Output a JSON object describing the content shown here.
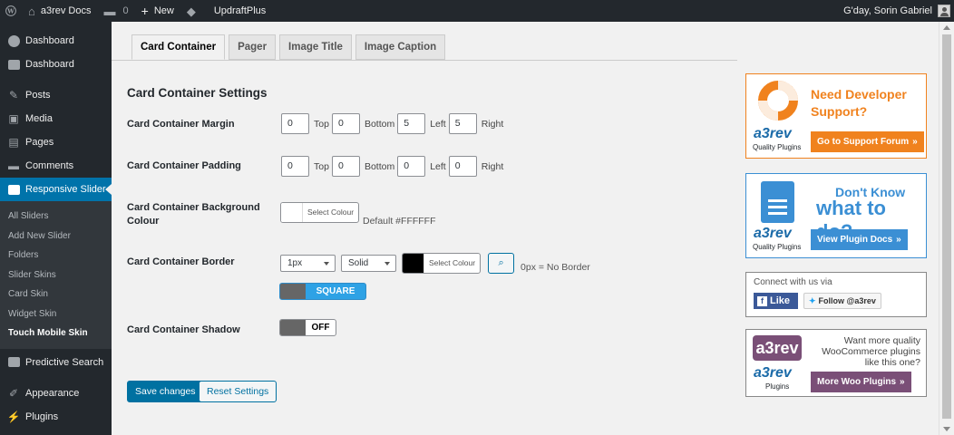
{
  "adminbar": {
    "site_name": "a3rev Docs",
    "comments_count": "0",
    "new_label": "New",
    "updraft_label": "UpdraftPlus",
    "greeting": "G'day, Sorin Gabriel"
  },
  "sidebar": {
    "items_top": [
      {
        "label": "Dashboard",
        "icon": "gauge-icon"
      },
      {
        "label": "Dashboard",
        "icon": "a3-icon"
      }
    ],
    "items_mid": [
      {
        "label": "Posts",
        "icon": "pin-icon"
      },
      {
        "label": "Media",
        "icon": "media-icon"
      },
      {
        "label": "Pages",
        "icon": "pages-icon"
      },
      {
        "label": "Comments",
        "icon": "comment-icon"
      }
    ],
    "current": {
      "label": "Responsive Slider",
      "icon": "slider-icon"
    },
    "submenu": [
      "All Sliders",
      "Add New Slider",
      "Folders",
      "Slider Skins",
      "Card Skin",
      "Widget Skin",
      "Touch Mobile Skin"
    ],
    "items_bottom": [
      {
        "label": "Predictive Search",
        "icon": "a3-icon"
      },
      {
        "label": "Appearance",
        "icon": "brush-icon"
      },
      {
        "label": "Plugins",
        "icon": "plug-icon"
      }
    ]
  },
  "tabs": [
    "Card Container",
    "Pager",
    "Image Title",
    "Image Caption"
  ],
  "settings": {
    "title": "Card Container Settings",
    "margin": {
      "label": "Card Container Margin",
      "top": "0",
      "bottom": "0",
      "left": "5",
      "right": "5",
      "top_label": "Top",
      "bottom_label": "Bottom",
      "left_label": "Left",
      "right_label": "Right"
    },
    "padding": {
      "label": "Card Container Padding",
      "top": "0",
      "bottom": "0",
      "left": "0",
      "right": "0",
      "top_label": "Top",
      "bottom_label": "Bottom",
      "left_label": "Left",
      "right_label": "Right"
    },
    "background": {
      "label_line1": "Card Container Background",
      "label_line2": "Colour",
      "button_label": "Select Colour",
      "default_text": "Default #FFFFFF",
      "swatch_color": "#ffffff"
    },
    "border": {
      "label": "Card Container Border",
      "width_value": "1px",
      "style_value": "Solid",
      "colour_button_label": "Select Colour",
      "swatch_color": "#000000",
      "hint": "0px = No Border",
      "corner_toggle": "SQUARE"
    },
    "shadow": {
      "label": "Card Container Shadow",
      "toggle": "OFF"
    },
    "save_label": "Save changes",
    "reset_label": "Reset Settings"
  },
  "promo": {
    "support": {
      "heading": "Need Developer Support?",
      "button": "Go to Support Forum",
      "logo": "a3rev",
      "logo_sub": "Quality Plugins"
    },
    "docs": {
      "heading_small": "Don't Know",
      "heading_big": "what to do?",
      "button": "View Plugin Docs",
      "logo": "a3rev",
      "logo_sub": "Quality Plugins"
    },
    "social": {
      "connect": "Connect with us via",
      "like": "Like",
      "follow": "Follow @a3rev"
    },
    "woo": {
      "logo": "a3rev",
      "text": "Want more quality WooCommerce plugins like this one?",
      "button": "More Woo Plugins",
      "logo_sub": "Plugins"
    }
  },
  "colors": {
    "wp_blue": "#0073aa",
    "admin_dark": "#23282d",
    "orange": "#f0821e",
    "doc_blue": "#3b8fd4",
    "woo_purple": "#7a4f77"
  }
}
